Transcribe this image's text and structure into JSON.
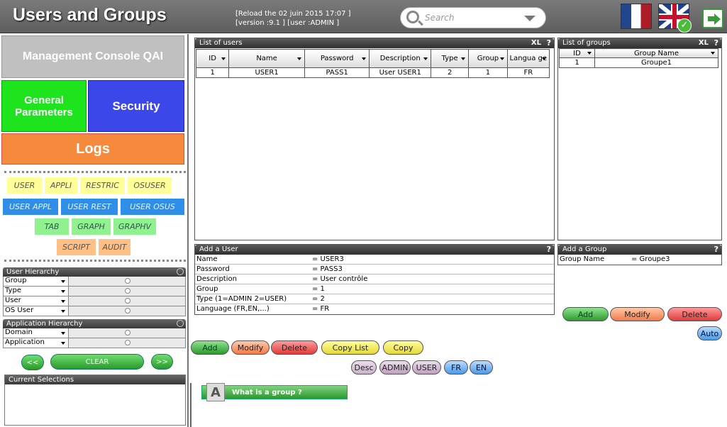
{
  "header": {
    "title": "Users and Groups",
    "reload_line": "[Reload the 02 juin 2015 17:07 ]",
    "version_line": "[version :9.1 ]  [user :ADMIN ]",
    "search_placeholder": "Search",
    "flags": [
      "fr-flag-icon",
      "en-flag-icon"
    ]
  },
  "menu": {
    "management": "Management Console QAI",
    "general": "General Parameters",
    "security": "Security",
    "logs": "Logs"
  },
  "tags": {
    "row1": [
      "USER",
      "APPLI",
      "RESTRIC",
      "OSUSER"
    ],
    "row2": [
      "USER APPL",
      "USER REST",
      "USER OSUS"
    ],
    "row3": [
      "TAB",
      "GRAPH",
      "GRAPHV"
    ],
    "row4": [
      "SCRIPT",
      "AUDIT"
    ]
  },
  "user_hierarchy": {
    "title": "User Hierarchy",
    "rows": [
      "Group",
      "Type",
      "User",
      "OS User"
    ]
  },
  "app_hierarchy": {
    "title": "Application Hierarchy",
    "rows": [
      "Domain",
      "Application"
    ]
  },
  "nav": {
    "prev": "<<",
    "clear": "CLEAR",
    "next": ">>"
  },
  "current_selections": {
    "title": "Current Selections"
  },
  "users_panel": {
    "title": "List of users",
    "xl": "XL",
    "help": "?",
    "columns": [
      "ID",
      "Name",
      "Password",
      "Description",
      "Type",
      "Group",
      "Langua ge"
    ],
    "rows": [
      [
        "1",
        "USER1",
        "PASS1",
        "User USER1",
        "2",
        "1",
        "FR"
      ]
    ]
  },
  "groups_panel": {
    "title": "List of groups",
    "xl": "XL",
    "help": "?",
    "columns": [
      "ID",
      "Group Name"
    ],
    "rows": [
      [
        "1",
        "Groupe1"
      ]
    ]
  },
  "add_user": {
    "title": "Add a User",
    "help": "?",
    "fields": [
      {
        "label": "Name",
        "value": "=  USER3"
      },
      {
        "label": "Password",
        "value": "=  PASS3"
      },
      {
        "label": "Description",
        "value": "=  User contrôle"
      },
      {
        "label": "Group",
        "value": "=  1"
      },
      {
        "label": "Type (1=ADMIN 2=USER)",
        "value": "=  2"
      },
      {
        "label": "Language  (FR,EN,...)",
        "value": "=  FR"
      }
    ]
  },
  "add_group": {
    "title": "Add  a Group",
    "help": "?",
    "fields": [
      {
        "label": "Group Name",
        "value": "=  Groupe3"
      }
    ]
  },
  "group_buttons": {
    "add": "Add",
    "modify": "Modify",
    "delete": "Delete",
    "auto": "Auto"
  },
  "user_buttons": {
    "add": "Add",
    "modify": "Modify",
    "delete": "Delete",
    "copy_list": "Copy List",
    "copy": "Copy"
  },
  "filters": [
    "Desc",
    "ADMIN",
    "USER",
    "FR",
    "EN"
  ],
  "help_link": {
    "icon_letter": "A",
    "label": "What is a group ?"
  }
}
